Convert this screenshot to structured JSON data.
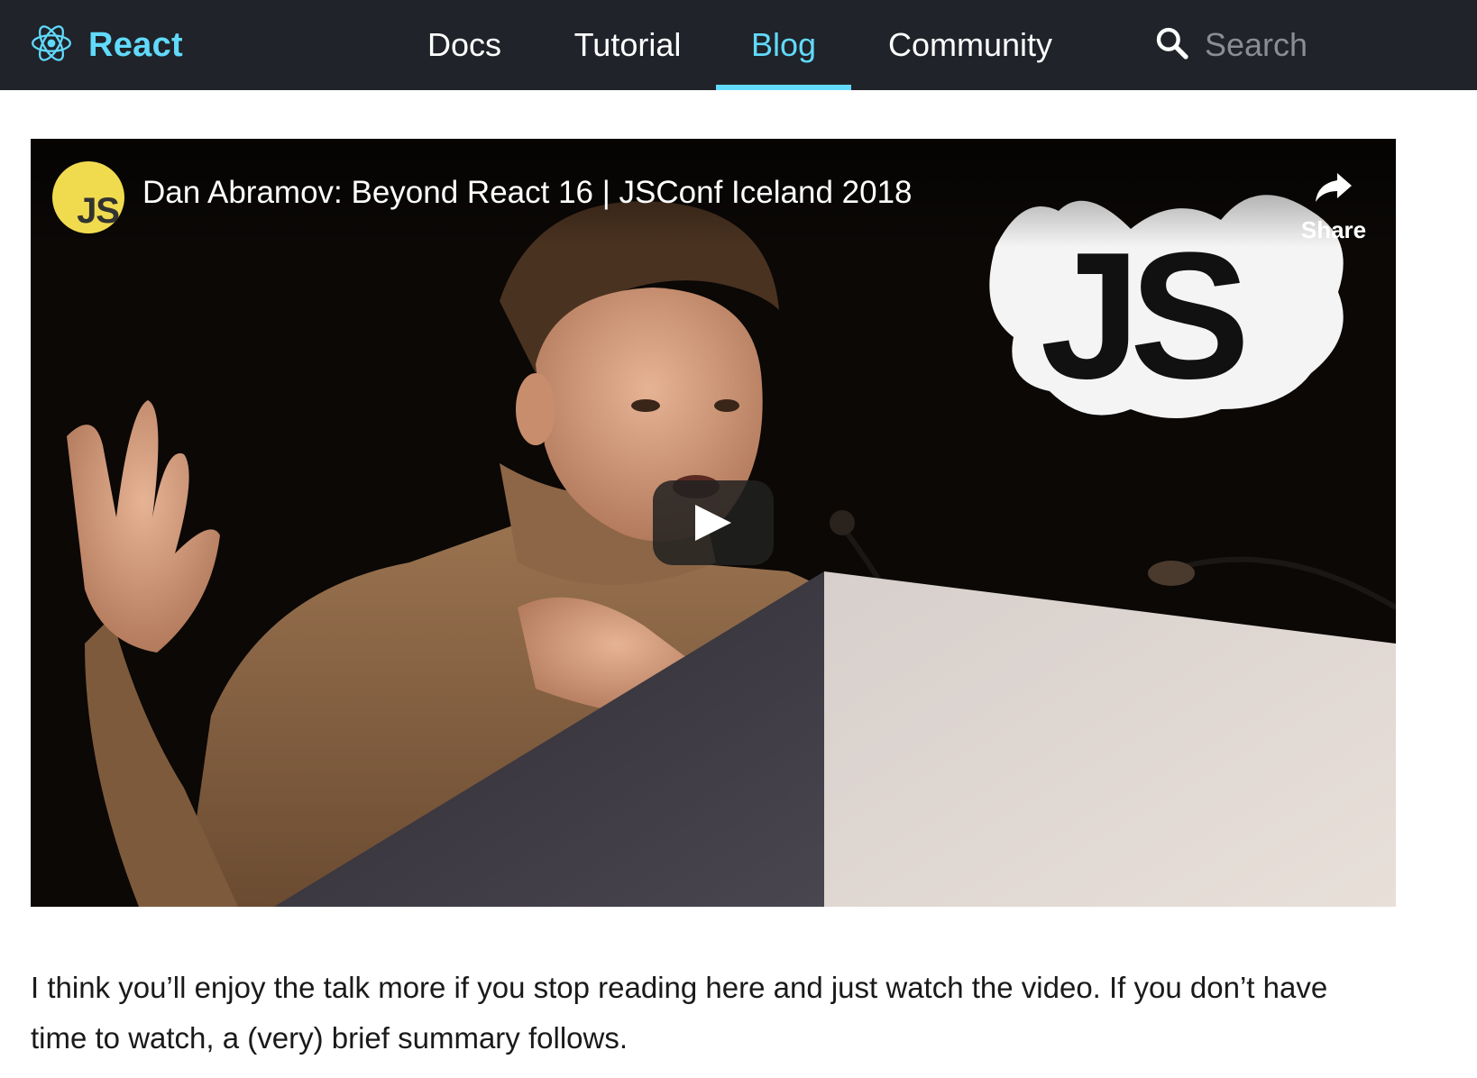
{
  "header": {
    "brand": "React",
    "nav": [
      {
        "label": "Docs",
        "active": false
      },
      {
        "label": "Tutorial",
        "active": false
      },
      {
        "label": "Blog",
        "active": true
      },
      {
        "label": "Community",
        "active": false
      }
    ],
    "search_placeholder": "Search"
  },
  "video": {
    "channel_badge": "JS",
    "title": "Dan Abramov: Beyond React 16 | JSConf Iceland 2018",
    "share_label": "Share",
    "logo_text": "JS"
  },
  "article": {
    "paragraph": "I think you’ll enjoy the talk more if you stop reading here and just watch the video. If you don’t have time to watch, a (very) brief summary follows."
  },
  "colors": {
    "nav_bg": "#20232a",
    "accent": "#61dafb",
    "js_yellow": "#f0db4f"
  },
  "icons": [
    "react-logo-icon",
    "search-icon",
    "share-icon",
    "play-icon"
  ]
}
